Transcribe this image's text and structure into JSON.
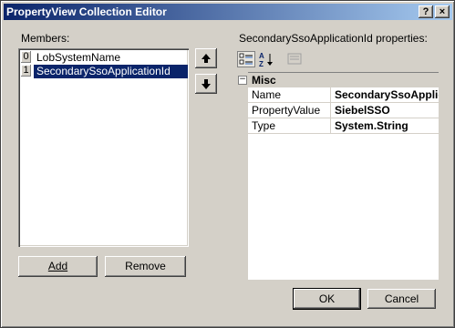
{
  "window": {
    "title": "PropertyView Collection Editor",
    "help_glyph": "?",
    "close_glyph": "×"
  },
  "members": {
    "label": "Members:",
    "items": [
      {
        "index": "0",
        "name": "LobSystemName"
      },
      {
        "index": "1",
        "name": "SecondarySsoApplicationId"
      }
    ],
    "selected_index": 1
  },
  "buttons": {
    "up_glyph": "🡅",
    "down_glyph": "🡇",
    "add": "Add",
    "remove": "Remove",
    "ok": "OK",
    "cancel": "Cancel"
  },
  "properties": {
    "label": "SecondarySsoApplicationId properties:",
    "category": "Misc",
    "category_toggle": "−",
    "rows": [
      {
        "name": "Name",
        "value": "SecondarySsoApplicationId"
      },
      {
        "name": "PropertyValue",
        "value": "SiebelSSO"
      },
      {
        "name": "Type",
        "value": "System.String"
      }
    ]
  }
}
